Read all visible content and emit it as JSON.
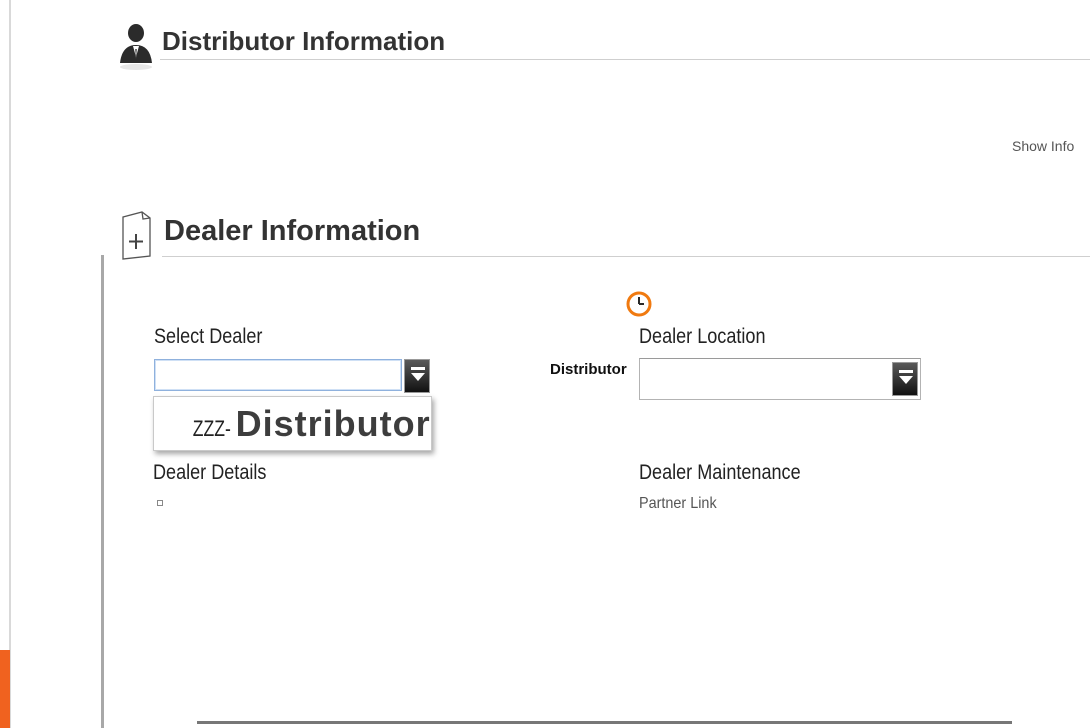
{
  "distributor_section": {
    "title": "Distributor Information",
    "show_info_label": "Show Info"
  },
  "dealer_section": {
    "title": "Dealer Information",
    "select_dealer": {
      "label": "Select Dealer",
      "input_value": "",
      "dropdown_options": [
        {
          "prefix": "ZZZ-",
          "name": "Distributor"
        }
      ]
    },
    "dealer_location": {
      "label": "Dealer Location",
      "value": "",
      "side_label": "Distributor"
    },
    "dealer_details": {
      "label": "Dealer Details"
    },
    "dealer_maintenance": {
      "label": "Dealer Maintenance",
      "link_label": "Partner Link"
    }
  },
  "icons": [
    "person-icon",
    "add-document-icon",
    "clock-icon",
    "dropdown-arrow-icon"
  ],
  "colors": {
    "accent": "#f0621f",
    "clock": "#f07a10",
    "input_focus_border": "#8fb1dd"
  }
}
